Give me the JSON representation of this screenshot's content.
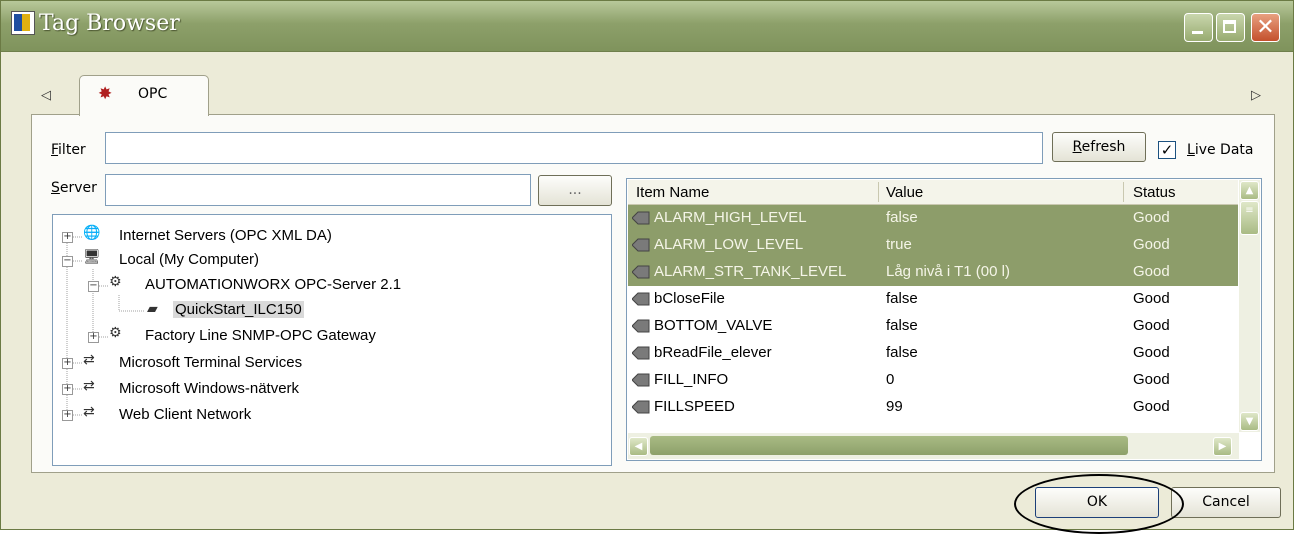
{
  "window": {
    "title": "Tag Browser"
  },
  "tabs": [
    {
      "label": "OPC",
      "icon": "opc-network-icon"
    }
  ],
  "filter": {
    "label": "Filter",
    "accesskey": "F",
    "rest": "ilter",
    "value": ""
  },
  "refresh_button": {
    "accesskey": "R",
    "rest": "efresh"
  },
  "live_data": {
    "accesskey": "L",
    "rest": "ive Data",
    "checked": true,
    "check_glyph": "✓"
  },
  "server": {
    "label_accesskey": "S",
    "label_rest": "erver",
    "value": "",
    "browse_label": "..."
  },
  "tree": {
    "items": [
      {
        "label": "Internet Servers (OPC XML DA)",
        "icon": "globe-server-icon",
        "expander": "+"
      },
      {
        "label": "Local (My Computer)",
        "icon": "computer-icon",
        "expander": "−"
      },
      {
        "label": "AUTOMATIONWORX OPC-Server 2.1",
        "icon": "gears-icon",
        "expander": "−"
      },
      {
        "label": "QuickStart_ILC150",
        "icon": "project-icon",
        "expander": ""
      },
      {
        "label": "Factory Line SNMP-OPC Gateway",
        "icon": "gears-icon",
        "expander": "+"
      },
      {
        "label": "Microsoft Terminal Services",
        "icon": "network-arrows-icon",
        "expander": "+"
      },
      {
        "label": "Microsoft Windows-nätverk",
        "icon": "network-arrows-icon",
        "expander": "+"
      },
      {
        "label": "Web Client Network",
        "icon": "network-arrows-icon",
        "expander": "+"
      }
    ]
  },
  "grid": {
    "columns": [
      "Item Name",
      "Value",
      "Status"
    ],
    "rows": [
      {
        "name": "ALARM_HIGH_LEVEL",
        "value": "false",
        "status": "Good",
        "selected": true
      },
      {
        "name": "ALARM_LOW_LEVEL",
        "value": "true",
        "status": "Good",
        "selected": true
      },
      {
        "name": "ALARM_STR_TANK_LEVEL",
        "value": "Låg nivå i T1 (00 l)",
        "status": "Good",
        "selected": true
      },
      {
        "name": "bCloseFile",
        "value": "false",
        "status": "Good",
        "selected": false
      },
      {
        "name": "BOTTOM_VALVE",
        "value": "false",
        "status": "Good",
        "selected": false
      },
      {
        "name": "bReadFile_elever",
        "value": "false",
        "status": "Good",
        "selected": false
      },
      {
        "name": "FILL_INFO",
        "value": "0",
        "status": "Good",
        "selected": false
      },
      {
        "name": "FILLSPEED",
        "value": "99",
        "status": "Good",
        "selected": false
      }
    ],
    "selection_color": "#8d9d6a"
  },
  "buttons": {
    "ok": "OK",
    "cancel": "Cancel"
  },
  "colors": {
    "titlebar": "#8da06a",
    "window_bg": "#ecebd8"
  }
}
